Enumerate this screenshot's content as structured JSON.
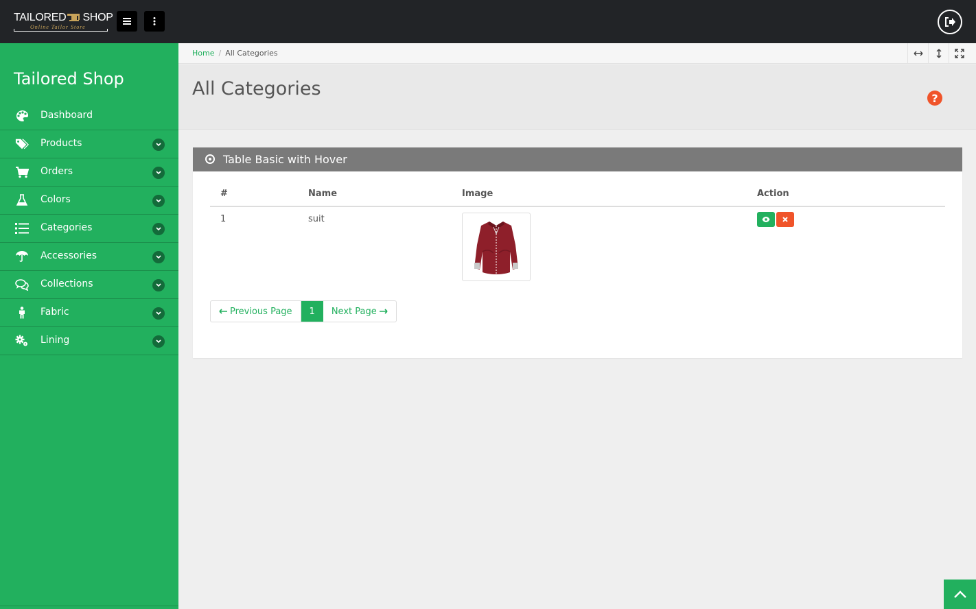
{
  "topbar": {
    "logo_main_left": "TAILORED",
    "logo_main_right": "SHOP",
    "logo_sub": "Online Tailor Store"
  },
  "sidebar": {
    "title": "Tailored Shop",
    "items": [
      {
        "label": "Dashboard",
        "icon": "palette-icon",
        "has_submenu": false
      },
      {
        "label": "Products",
        "icon": "tags-icon",
        "has_submenu": true
      },
      {
        "label": "Orders",
        "icon": "cart-icon",
        "has_submenu": true
      },
      {
        "label": "Colors",
        "icon": "flask-icon",
        "has_submenu": true
      },
      {
        "label": "Categories",
        "icon": "list-icon",
        "has_submenu": true
      },
      {
        "label": "Accessories",
        "icon": "umbrella-icon",
        "has_submenu": true
      },
      {
        "label": "Collections",
        "icon": "comments-icon",
        "has_submenu": true
      },
      {
        "label": "Fabric",
        "icon": "person-icon",
        "has_submenu": true
      },
      {
        "label": "Lining",
        "icon": "puzzle-icon",
        "has_submenu": true
      }
    ]
  },
  "breadcrumb": {
    "home": "Home",
    "separator": "/",
    "current": "All Categories"
  },
  "page": {
    "title": "All Categories"
  },
  "panel": {
    "title": "Table Basic with Hover",
    "columns": [
      "#",
      "Name",
      "Image",
      "Action"
    ],
    "rows": [
      {
        "num": "1",
        "name": "suit",
        "image": "red-shirt"
      }
    ]
  },
  "pagination": {
    "prev_label": "Previous Page",
    "current": "1",
    "next_label": "Next Page"
  },
  "colors": {
    "accent": "#22b05e",
    "danger": "#f0542a",
    "topbar": "#222427",
    "panel_head": "#7a7a7a"
  }
}
